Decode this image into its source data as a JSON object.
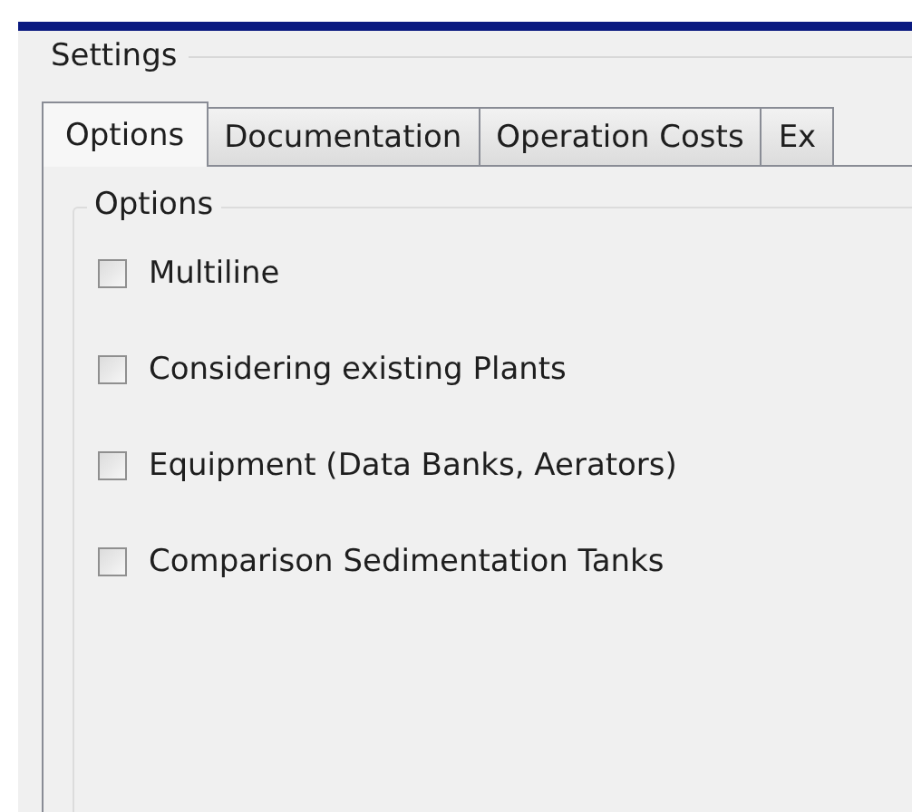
{
  "group": {
    "title": "Settings"
  },
  "tabs": [
    {
      "label": "Options",
      "selected": true
    },
    {
      "label": "Documentation",
      "selected": false
    },
    {
      "label": "Operation Costs",
      "selected": false
    },
    {
      "label": "Ex",
      "selected": false
    }
  ],
  "options_group": {
    "title": "Options",
    "checkboxes": [
      {
        "label": "Multiline",
        "checked": false
      },
      {
        "label": "Considering existing Plants",
        "checked": false
      },
      {
        "label": "Equipment (Data Banks, Aerators)",
        "checked": false
      },
      {
        "label": "Comparison Sedimentation Tanks",
        "checked": false
      }
    ]
  }
}
